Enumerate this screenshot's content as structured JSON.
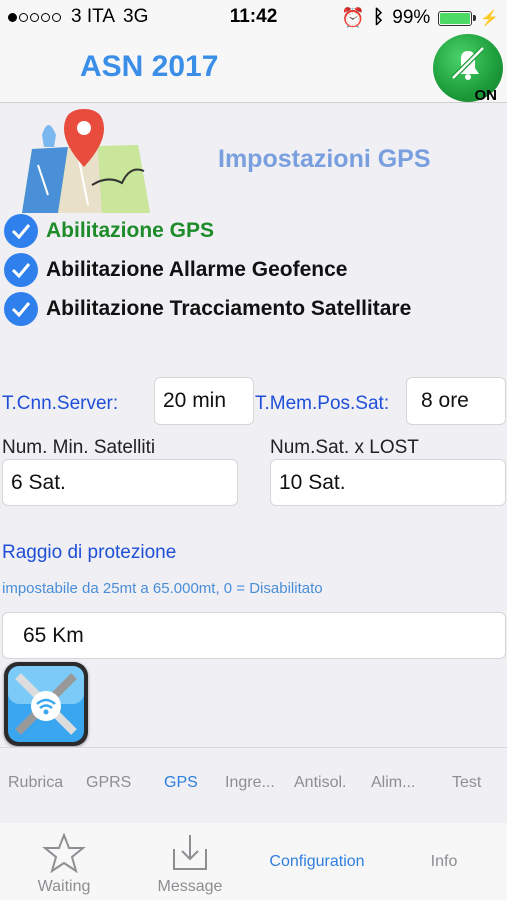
{
  "status_bar": {
    "carrier": "3 ITA",
    "network": "3G",
    "time": "11:42",
    "battery_pct": "99%",
    "battery_fill": 0.99
  },
  "header": {
    "app_title": "ASN 2017",
    "toggle_label": "ON"
  },
  "gps": {
    "section_title": "Impostazioni GPS",
    "checks": [
      {
        "label": "Abilitazione  GPS",
        "checked": true
      },
      {
        "label": "Abilitazione Allarme Geofence",
        "checked": true
      },
      {
        "label": "Abilitazione Tracciamento Satellitare",
        "checked": true
      }
    ],
    "server_label": "T.Cnn.Server:",
    "server_value": "20 min",
    "mem_label": "T.Mem.Pos.Sat:",
    "mem_value": "8 ore",
    "min_sat_label": "Num. Min. Satelliti",
    "min_sat_value": "6 Sat.",
    "lost_label": "Num.Sat. x LOST",
    "lost_value": "10 Sat.",
    "radius_label": "Raggio di protezione",
    "radius_hint": "impostabile da 25mt a 65.000mt, 0 = Disabilitato",
    "radius_value": "65 Km"
  },
  "segments": [
    {
      "label": "Rubrica",
      "active": false
    },
    {
      "label": "GPRS",
      "active": false
    },
    {
      "label": "GPS",
      "active": true
    },
    {
      "label": "Ingre...",
      "active": false
    },
    {
      "label": "Antisol.",
      "active": false
    },
    {
      "label": "Alim...",
      "active": false
    },
    {
      "label": "Test",
      "active": false
    }
  ],
  "tabs": [
    {
      "label": "Waiting",
      "icon": "star-icon"
    },
    {
      "label": "Message",
      "icon": "download-tray-icon"
    },
    {
      "label": "Configuration",
      "active": true
    },
    {
      "label": "Info"
    }
  ],
  "colors": {
    "accent": "#2f7fe0",
    "check_blue": "#2f80ed",
    "gps_enabled_green": "#1e8c2a",
    "toggle_green": "#1c9c3a"
  }
}
